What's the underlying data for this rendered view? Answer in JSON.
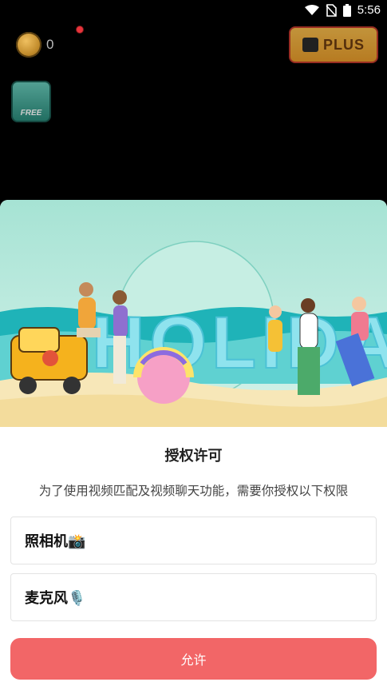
{
  "status_bar": {
    "time": "5:56"
  },
  "game": {
    "coin_count": "0",
    "plus_label": "PLUS",
    "free_label": "FREE"
  },
  "banner": {
    "text": "HOLIDAY"
  },
  "dialog": {
    "title": "授权许可",
    "description": "为了使用视频匹配及视频聊天功能，需要你授权以下权限",
    "permissions": [
      {
        "label": "照相机📸"
      },
      {
        "label": "麦克风🎙️"
      }
    ],
    "allow_label": "允许"
  },
  "colors": {
    "accent": "#f26667",
    "banner_sky": "#a6e3d4",
    "sand": "#f7e7b8"
  }
}
